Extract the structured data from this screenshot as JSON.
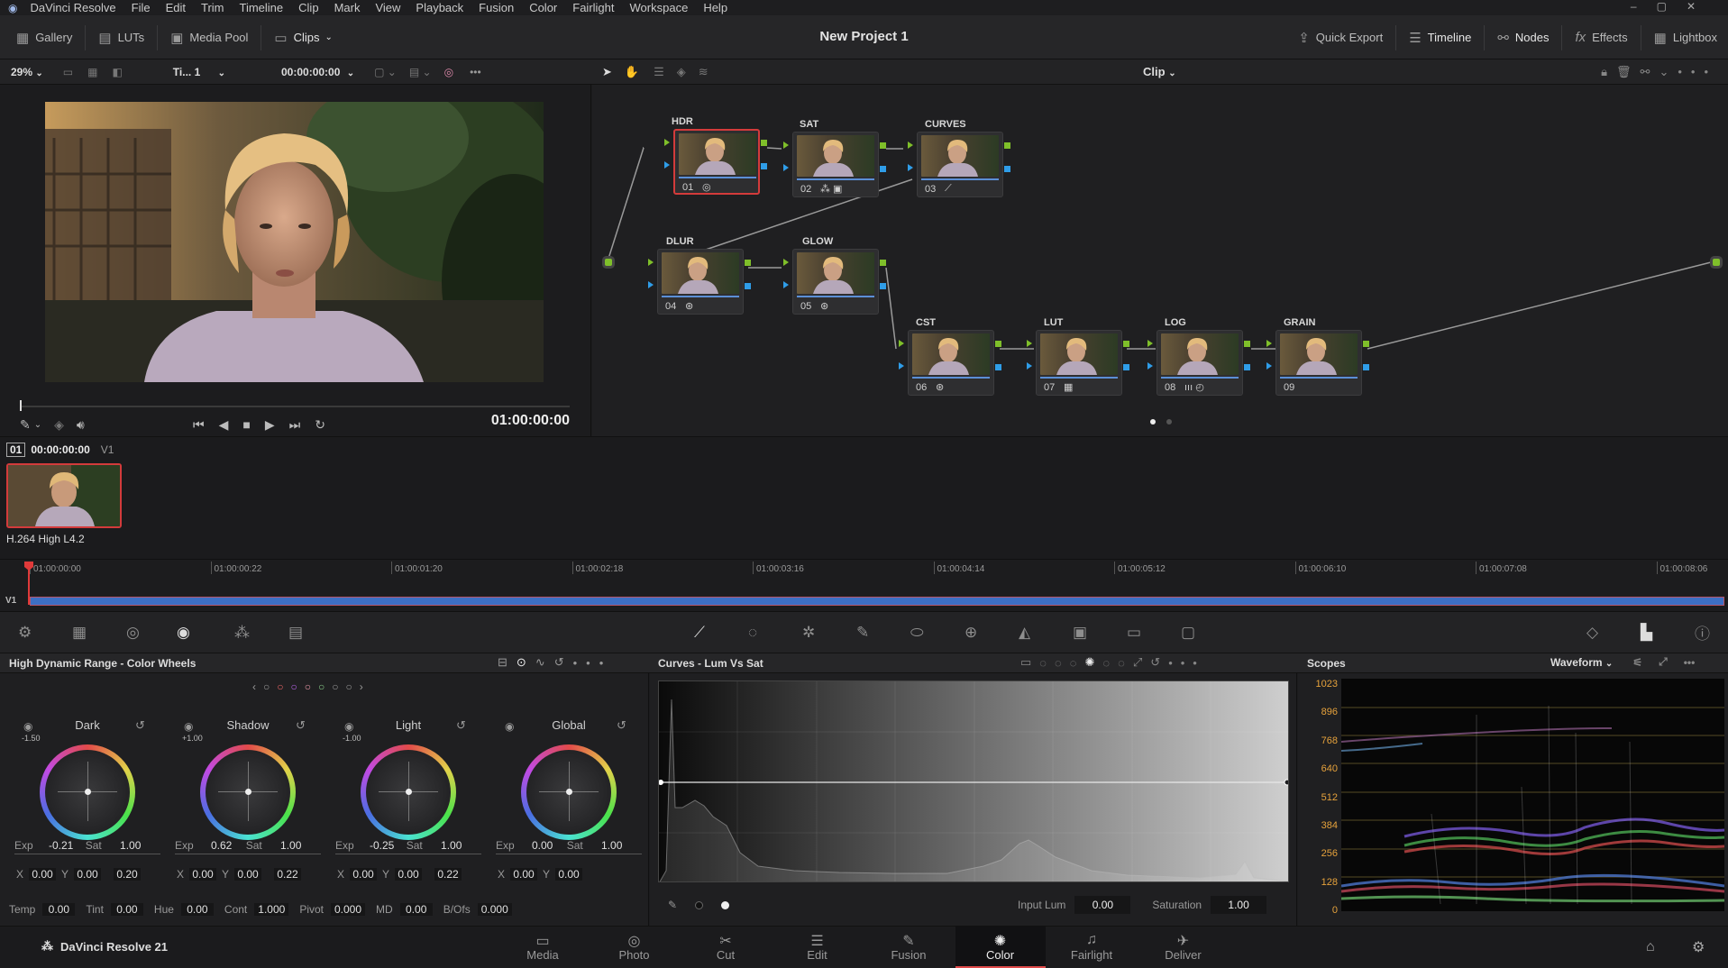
{
  "menubar": {
    "app_name": "DaVinci Resolve",
    "items": [
      "File",
      "Edit",
      "Trim",
      "Timeline",
      "Clip",
      "Mark",
      "View",
      "Playback",
      "Fusion",
      "Color",
      "Fairlight",
      "Workspace",
      "Help"
    ]
  },
  "toolbar": {
    "left": [
      "Gallery",
      "LUTs",
      "Media Pool",
      "Clips"
    ],
    "project_title": "New Project 1",
    "right": [
      "Quick Export",
      "Timeline",
      "Nodes",
      "Effects",
      "Lightbox"
    ]
  },
  "viewer": {
    "zoom": "29%",
    "timeline_name": "Ti... 1",
    "timecode_top": "00:00:00:00",
    "timecode": "01:00:00:00"
  },
  "nodebar": {
    "mode": "Clip"
  },
  "nodes": [
    {
      "label": "HDR",
      "num": "01",
      "icon": "hdr-icon",
      "selected": true
    },
    {
      "label": "SAT",
      "num": "02",
      "icon": "sat-icon",
      "selected": false
    },
    {
      "label": "CURVES",
      "num": "03",
      "icon": "curve-icon",
      "selected": false
    },
    {
      "label": "DLUR",
      "num": "04",
      "icon": "fx-icon",
      "selected": false
    },
    {
      "label": "GLOW",
      "num": "05",
      "icon": "fx-icon",
      "selected": false
    },
    {
      "label": "CST",
      "num": "06",
      "icon": "fx-icon",
      "selected": false
    },
    {
      "label": "LUT",
      "num": "07",
      "icon": "lut-icon",
      "selected": false
    },
    {
      "label": "LOG",
      "num": "08",
      "icon": "log-icon",
      "selected": false
    },
    {
      "label": "GRAIN",
      "num": "09",
      "icon": "",
      "selected": false
    }
  ],
  "clip": {
    "index": "01",
    "timecode": "00:00:00:00",
    "track": "V1",
    "codec": "H.264 High L4.2"
  },
  "timeline": {
    "ticks": [
      "01:00:00:00",
      "01:00:00:22",
      "01:00:01:20",
      "01:00:02:18",
      "01:00:03:16",
      "01:00:04:14",
      "01:00:05:12",
      "01:00:06:10",
      "01:00:07:08",
      "01:00:08:06"
    ],
    "track": "V1"
  },
  "panels": {
    "wheels_title": "High Dynamic Range - Color Wheels",
    "curves_title": "Curves - Lum Vs Sat",
    "scopes_title": "Scopes",
    "scope_mode": "Waveform"
  },
  "wheels": [
    {
      "name": "Dark",
      "zone": "-1.50",
      "exp": "-0.21",
      "sat": "1.00",
      "x": "0.00",
      "y": "0.00",
      "z": "0.20"
    },
    {
      "name": "Shadow",
      "zone": "+1.00",
      "exp": "0.62",
      "sat": "1.00",
      "x": "0.00",
      "y": "0.00",
      "z": "0.22"
    },
    {
      "name": "Light",
      "zone": "-1.00",
      "exp": "-0.25",
      "sat": "1.00",
      "x": "0.00",
      "y": "0.00",
      "z": "0.22"
    },
    {
      "name": "Global",
      "zone": "",
      "exp": "0.00",
      "sat": "1.00",
      "x": "0.00",
      "y": "0.00",
      "z": ""
    }
  ],
  "wheel_labels": {
    "exp": "Exp",
    "sat": "Sat",
    "x": "X",
    "y": "Y"
  },
  "bottom_params": [
    {
      "label": "Temp",
      "value": "0.00"
    },
    {
      "label": "Tint",
      "value": "0.00"
    },
    {
      "label": "Hue",
      "value": "0.00"
    },
    {
      "label": "Cont",
      "value": "1.000"
    },
    {
      "label": "Pivot",
      "value": "0.000"
    },
    {
      "label": "MD",
      "value": "0.00"
    },
    {
      "label": "B/Ofs",
      "value": "0.000"
    }
  ],
  "curves_footer": {
    "input_lum_label": "Input Lum",
    "input_lum": "0.00",
    "saturation_label": "Saturation",
    "saturation": "1.00"
  },
  "scope_ticks": [
    "1023",
    "896",
    "768",
    "640",
    "512",
    "384",
    "256",
    "128",
    "0"
  ],
  "pagenav": {
    "brand": "DaVinci Resolve 21",
    "pages": [
      "Media",
      "Photo",
      "Cut",
      "Edit",
      "Fusion",
      "Color",
      "Fairlight",
      "Deliver"
    ],
    "active": "Color"
  },
  "colors": {
    "accent_red": "#d33b3b",
    "node_green": "#7fbf2a",
    "node_blue": "#2f9de8",
    "text_orange": "#e6a23c"
  }
}
